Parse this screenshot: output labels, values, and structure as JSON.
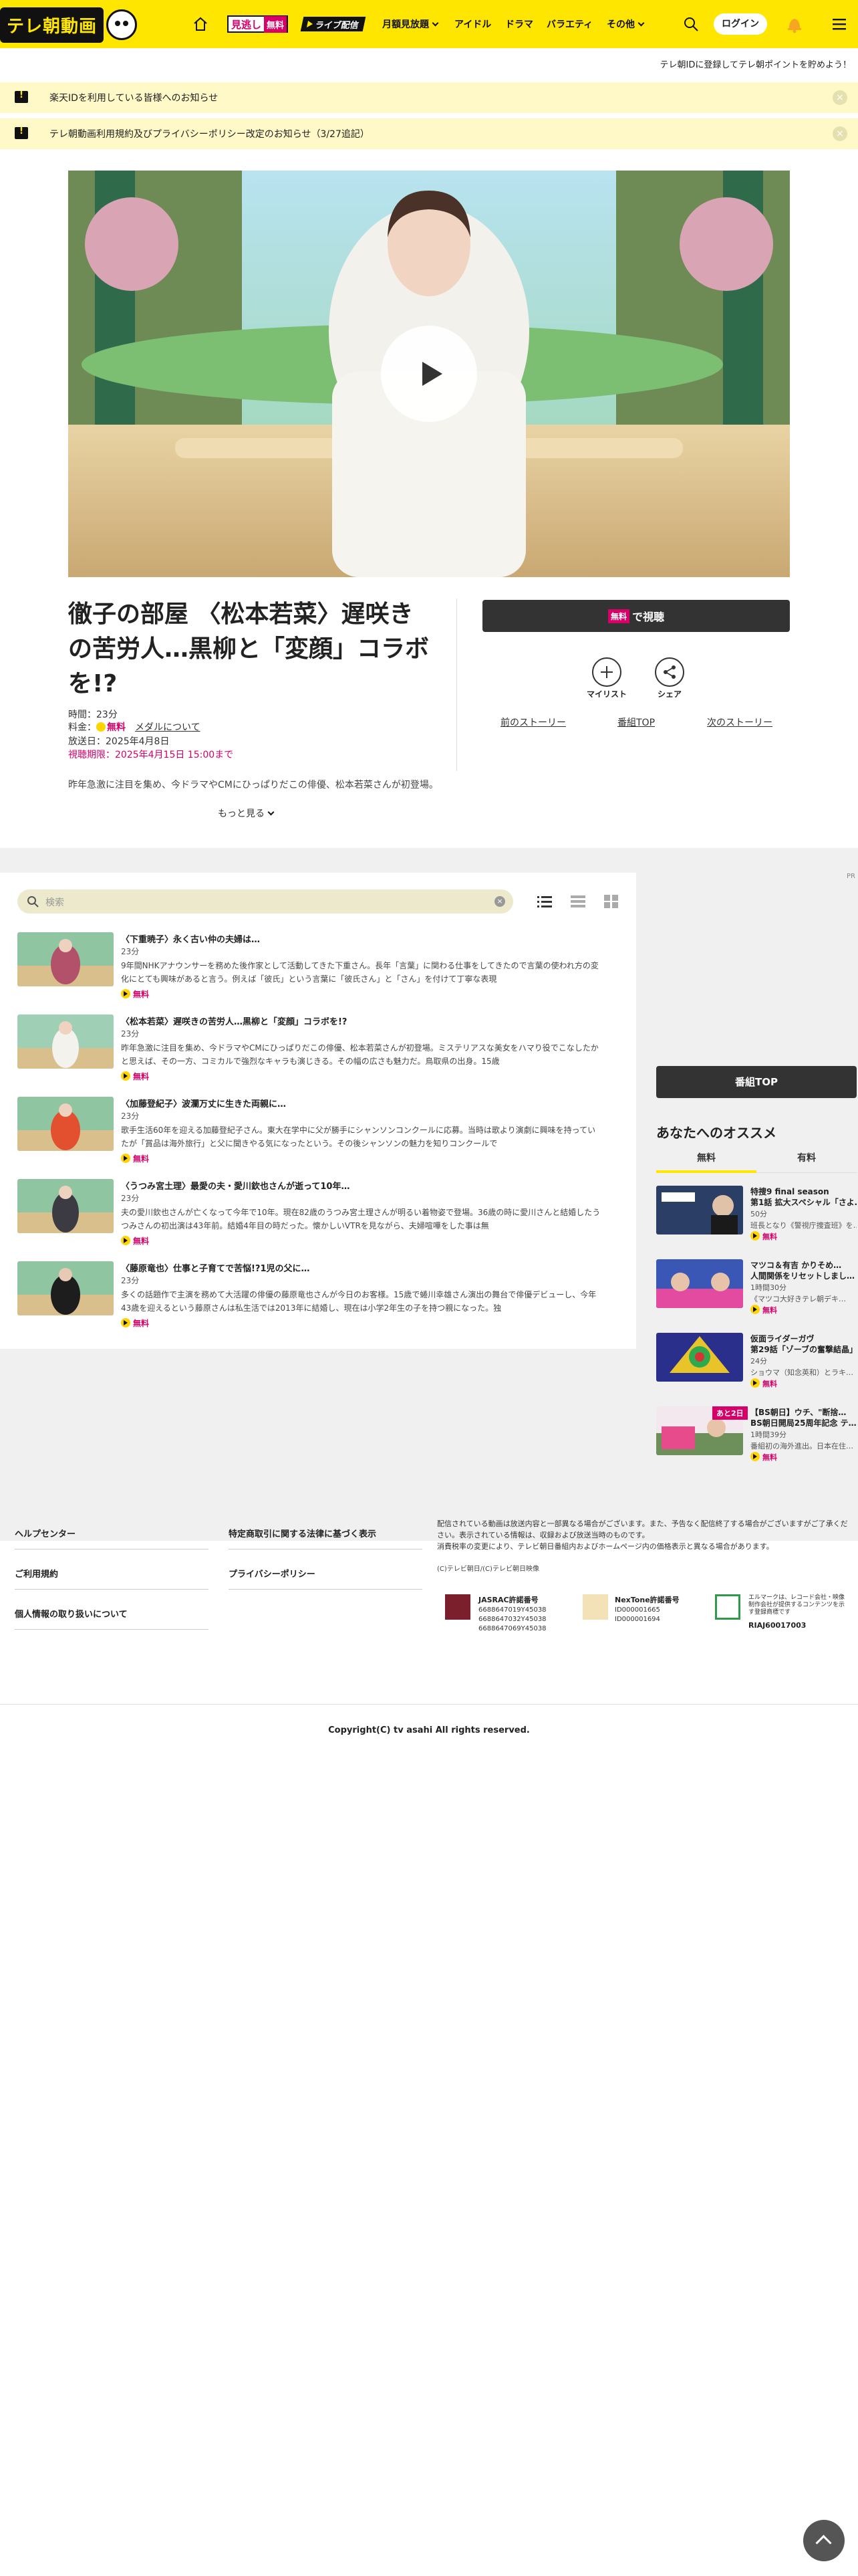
{
  "header": {
    "logo_text": "テレ朝動画",
    "mitai_label": "見逃し",
    "mitai_badge": "無料",
    "live_label": "ライブ配信",
    "nav": [
      {
        "label": "月額見放題"
      },
      {
        "label": "アイドル"
      },
      {
        "label": "ドラマ"
      },
      {
        "label": "バラエティ"
      },
      {
        "label": "その他"
      }
    ],
    "login_label": "ログイン"
  },
  "promo_text": "テレ朝IDに登録してテレ朝ポイントを貯めよう！",
  "notices": [
    {
      "text": "楽天IDを利用している皆様へのお知らせ"
    },
    {
      "text": "テレ朝動画利用規約及びプライバシーポリシー改定のお知らせ（3/27追記）"
    }
  ],
  "episode": {
    "title": "徹子の部屋 〈松本若菜〉遅咲きの苦労人…黒柳と「変顔」コラボを!?",
    "duration_label": "時間：23分",
    "price_label": "料金：",
    "price_value": "無料",
    "media_link": "メダルについて",
    "air_date": "放送日：2025年4月8日",
    "deadline": "視聴期限：2025年4月15日 15:00まで",
    "description": "昨年急激に注目を集め、今ドラマやCMにひっぱりだこの俳優、松本若菜さんが初登場。ミ",
    "more_label": "もっと見る",
    "watch_badge": "無料",
    "watch_label": "で視聴",
    "mylist_label": "マイリスト",
    "share_label": "シェア",
    "prev_label": "前のストーリー",
    "top_label": "番組TOP",
    "next_label": "次のストーリー"
  },
  "pr_tag": "PR",
  "search": {
    "placeholder": "検索",
    "clear": "×"
  },
  "episodes": [
    {
      "title": "〈下重暁子〉永く古い仲の夫婦は…",
      "duration": "23分",
      "desc": "9年間NHKアナウンサーを務めた後作家として活動してきた下重さん。長年「言葉」に関わる仕事をしてきたので言葉の使われ方の変化にとても興味があると言う。例えば「彼氏」という言葉に「彼氏さん」と「さん」を付けて丁寧な表現",
      "free": "無料"
    },
    {
      "title": "〈松本若菜〉遅咲きの苦労人…黒柳と「変顔」コラボを!?",
      "duration": "23分",
      "desc": "昨年急激に注目を集め、今ドラマやCMにひっぱりだこの俳優、松本若菜さんが初登場。ミステリアスな美女をハマり役でこなしたかと思えば、その一方、コミカルで強烈なキャラも演じきる。その幅の広さも魅力だ。鳥取県の出身。15歳",
      "free": "無料"
    },
    {
      "title": "〈加藤登紀子〉波瀾万丈に生きた両親に…",
      "duration": "23分",
      "desc": "歌手生活60年を迎える加藤登紀子さん。東大在学中に父が勝手にシャンソンコンクールに応募。当時は歌より演劇に興味を持っていたが「賞品は海外旅行」と父に聞きやる気になったという。その後シャンソンの魅力を知りコンクールで",
      "free": "無料"
    },
    {
      "title": "〈うつみ宮土理〉最愛の夫・愛川欽也さんが逝って10年…",
      "duration": "23分",
      "desc": "夫の愛川欽也さんが亡くなって今年で10年。現在82歳のうつみ宮土理さんが明るい着物姿で登場。36歳の時に愛川さんと結婚したうつみさんの初出演は43年前。結婚4年目の時だった。懐かしいVTRを見ながら、夫婦喧嘩をした事は無",
      "free": "無料"
    },
    {
      "title": "〈藤原竜也〉仕事と子育てで苦悩!?1児の父に…",
      "duration": "23分",
      "desc": "多くの話題作で主演を務めて大活躍の俳優の藤原竜也さんが今日のお客様。15歳で蜷川幸雄さん演出の舞台で俳優デビューし、今年43歳を迎えるという藤原さんは私生活では2013年に結婚し、現在は小学2年生の子を持つ親になった。独",
      "free": "無料"
    }
  ],
  "sidebar": {
    "program_top": "番組TOP",
    "reco_title": "あなたへのオススメ",
    "tabs": [
      {
        "label": "無料"
      },
      {
        "label": "有料"
      }
    ],
    "items": [
      {
        "title": "特捜9 final season",
        "title2": "第1話 拡大スペシャル「さよ…",
        "dur": "50分",
        "desc": "班長となり《警視庁捜査班》を…",
        "free": "無料"
      },
      {
        "title": "マツコ＆有吉 かりそめ…",
        "title2": "人間関係をリセットしまし…",
        "dur": "1時間30分",
        "desc": "《マツコ大好きテレ朝デキ…",
        "free": "無料"
      },
      {
        "title": "仮面ライダーガヴ",
        "title2": "第29話「ゾーブの奮撃結晶」",
        "dur": "24分",
        "desc": "ショウマ（知念英和）とラキ…",
        "free": "無料"
      },
      {
        "title": "【BS朝日】ウチ、\"断捨…",
        "title2": "BS朝日開局25周年記念 テ…",
        "dur": "1時間39分",
        "desc": "番組初の海外進出。日本在住…",
        "free": "無料",
        "badge": "あと2日"
      }
    ]
  },
  "footer": {
    "links_left": [
      {
        "label": "ヘルプセンター"
      },
      {
        "label": "ご利用規約"
      },
      {
        "label": "個人情報の取り扱いについて"
      }
    ],
    "links_mid": [
      {
        "label": "特定商取引に関する法律に基づく表示"
      },
      {
        "label": "プライバシーポリシー"
      }
    ],
    "note": "配信されている動画は放送内容と一部異なる場合がございます。また、予告なく配信終了する場合がございますがご了承ください。表示されている情報は、収録および放送当時のものです。",
    "note2": "消費税率の変更により、テレビ朝日番組内およびホームページ内の価格表示と異なる場合があります。",
    "copy_small": "(C)テレビ朝日/(C)テレビ朝日映像",
    "jasrac_title": "JASRAC許諾番号",
    "jasrac_nums": [
      "6688647019Y45038",
      "6688647032Y45038",
      "6688647069Y45038"
    ],
    "nextone_title": "NexTone許諾番号",
    "nextone_nums": [
      "ID000001665",
      "ID000001694"
    ],
    "lmark_text": "エルマークは、レコード会社・映像制作会社が提供するコンテンツを示す登録商標です",
    "lmark_num": "RIAJ60017003",
    "copyright": "Copyright(C) tv asahi All rights reserved."
  },
  "colors": {
    "brand_yellow": "#ffe600",
    "accent_pink": "#d60068",
    "dark_button": "#333333"
  }
}
